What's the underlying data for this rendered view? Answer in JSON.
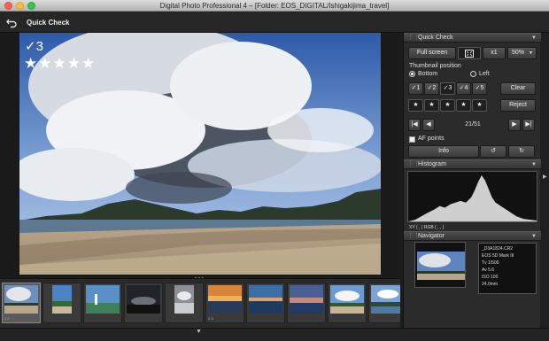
{
  "window": {
    "title": "Digital Photo Professional 4 – [Folder: EOS_DIGITAL/Ishigakijima_travel]"
  },
  "toolbar": {
    "title": "Quick Check"
  },
  "viewer": {
    "check_label": "✓3",
    "rating": 5,
    "stars_text": "★★★★★"
  },
  "panel": {
    "quick_check_header": "Quick Check",
    "full_screen_label": "Full screen",
    "zoom_x1_label": "x1",
    "zoom_percent": "50%",
    "thumbnail_position_label": "Thumbnail position",
    "pos_bottom_label": "Bottom",
    "pos_left_label": "Left",
    "check_marks": [
      "✓1",
      "✓2",
      "✓3",
      "✓4",
      "✓5"
    ],
    "clear_label": "Clear",
    "stars_row": [
      "★",
      "★",
      "★",
      "★",
      "★"
    ],
    "reject_label": "Reject",
    "counter": "21/51",
    "af_points_label": "AF points",
    "info_label": "Info",
    "histogram_header": "Histogram",
    "histogram_readout": "XY (        ,        )   RGB (        ,        ,        )",
    "navigator_header": "Navigator",
    "nav_info": [
      "_D3A1824.CR2",
      "EOS 5D Mark III",
      "Tv 1/500",
      "Av 5.6",
      "ISO 100",
      "24.0mm"
    ]
  },
  "filmstrip": {
    "thumbs": [
      {
        "caption": "2 2",
        "selected": true,
        "scene": "beach"
      },
      {
        "caption": "",
        "selected": false,
        "scene": "portrait"
      },
      {
        "caption": "",
        "selected": false,
        "scene": "lighthouse"
      },
      {
        "caption": "",
        "selected": false,
        "scene": "dark"
      },
      {
        "caption": "",
        "selected": false,
        "scene": "portrait-bw"
      },
      {
        "caption": "2 3",
        "selected": false,
        "scene": "sunset"
      },
      {
        "caption": "",
        "selected": false,
        "scene": "sunset-blue"
      },
      {
        "caption": "",
        "selected": false,
        "scene": "dusk"
      },
      {
        "caption": "",
        "selected": false,
        "scene": "clouds"
      },
      {
        "caption": "",
        "selected": false,
        "scene": "shore"
      }
    ]
  },
  "colors": {
    "panel": "#2b2b2b",
    "accent_selected": "#5a5a5a",
    "photo_sky": "#4a72b8"
  }
}
